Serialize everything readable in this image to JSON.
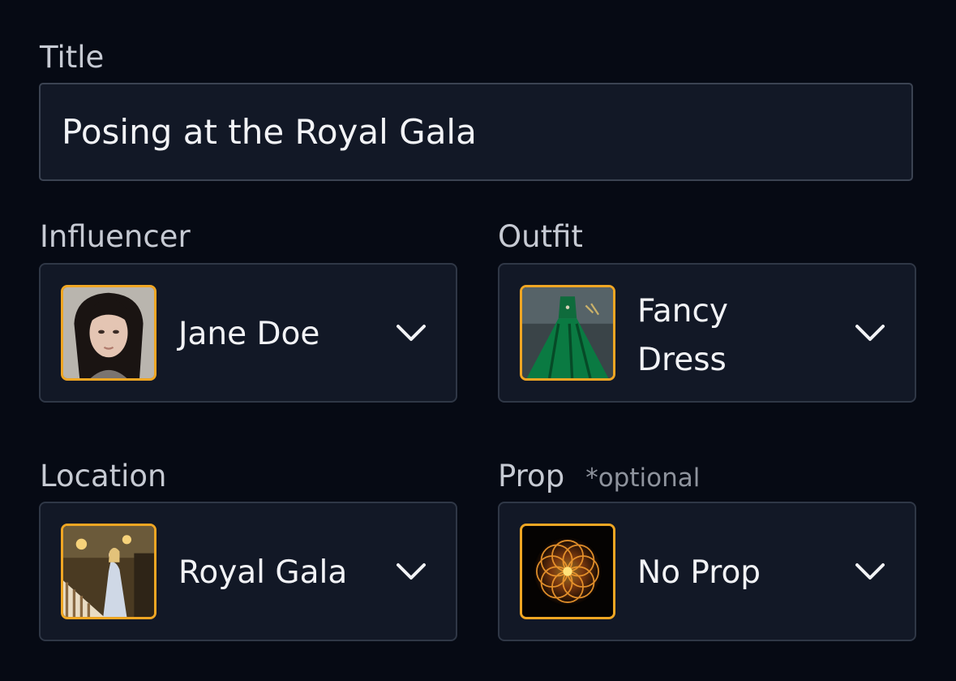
{
  "form": {
    "title": {
      "label": "Title",
      "value": "Posing at the Royal Gala"
    },
    "influencer": {
      "label": "Influencer",
      "value": "Jane Doe",
      "thumb_icon": "portrait-thumbnail"
    },
    "outfit": {
      "label": "Outfit",
      "value_line1": "Fancy",
      "value_line2": "Dress",
      "thumb_icon": "green-gown-thumbnail"
    },
    "location": {
      "label": "Location",
      "value": "Royal Gala",
      "thumb_icon": "ballroom-thumbnail"
    },
    "prop": {
      "label": "Prop",
      "hint": "*optional",
      "value": "No Prop",
      "thumb_icon": "mandala-thumbnail"
    }
  },
  "colors": {
    "background": "#060a14",
    "field": "#121826",
    "thumb_border": "#f0a623"
  }
}
